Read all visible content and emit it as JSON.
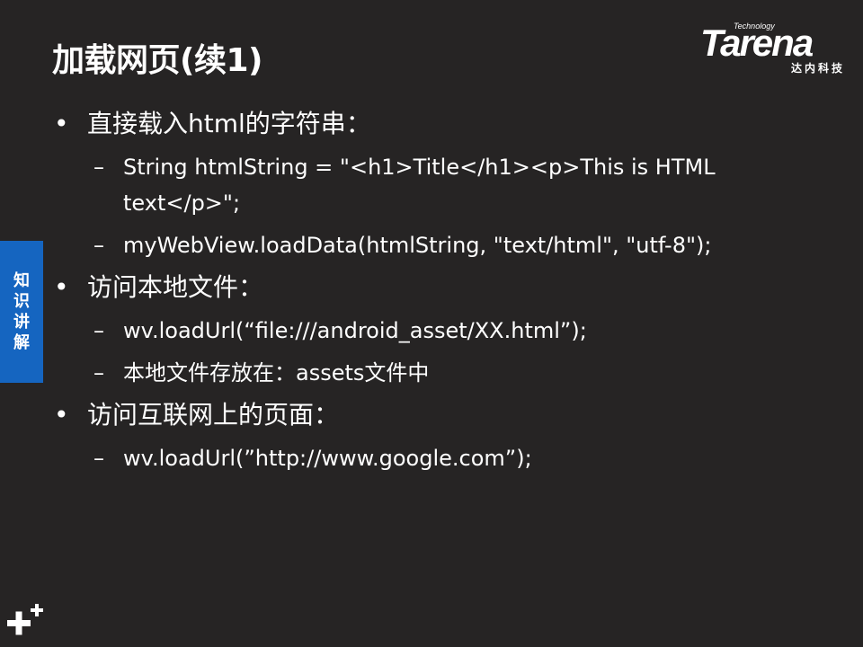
{
  "slide": {
    "title": "加载网页(续1)",
    "logo": {
      "small": "Technology",
      "brand": "Tarena",
      "subtitle": "达内科技"
    },
    "side_tab": "知识讲解",
    "bullets": [
      {
        "text": "直接载入html的字符串：",
        "subitems": [
          "String htmlString = \"<h1>Title</h1><p>This is HTML text</p>\";",
          "myWebView.loadData(htmlString, \"text/html\", \"utf-8\");"
        ]
      },
      {
        "text": "访问本地文件：",
        "subitems": [
          "wv.loadUrl(“file:///android_asset/XX.html”);",
          "本地文件存放在：assets文件中"
        ]
      },
      {
        "text": "访问互联网上的页面：",
        "subitems": [
          "wv.loadUrl(”http://www.google.com”);"
        ]
      }
    ],
    "bullet_symbol": "•",
    "dash_symbol": "–"
  }
}
